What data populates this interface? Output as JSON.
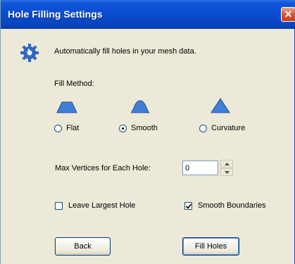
{
  "window": {
    "title": "Hole Filling Settings",
    "close_glyph": "✕"
  },
  "intro": {
    "icon": "gear-icon",
    "text": "Automatically fill holes in your mesh data."
  },
  "fill_method": {
    "label": "Fill Method:",
    "options": [
      {
        "label": "Flat",
        "icon": "flat-shape-icon",
        "selected": false
      },
      {
        "label": "Smooth",
        "icon": "smooth-shape-icon",
        "selected": true
      },
      {
        "label": "Curvature",
        "icon": "curvature-shape-icon",
        "selected": false
      }
    ]
  },
  "max_vertices": {
    "label": "Max Vertices for Each Hole:",
    "value": "0"
  },
  "options": {
    "leave_largest_hole": {
      "label": "Leave Largest Hole",
      "checked": false
    },
    "smooth_boundaries": {
      "label": "Smooth Boundaries",
      "checked": true
    }
  },
  "buttons": {
    "back": "Back",
    "fill_holes": "Fill Holes"
  },
  "colors": {
    "titlebar": "#0a4ccf",
    "dialog_bg": "#ece9d8",
    "shape_fill": "#3f7fd6"
  }
}
